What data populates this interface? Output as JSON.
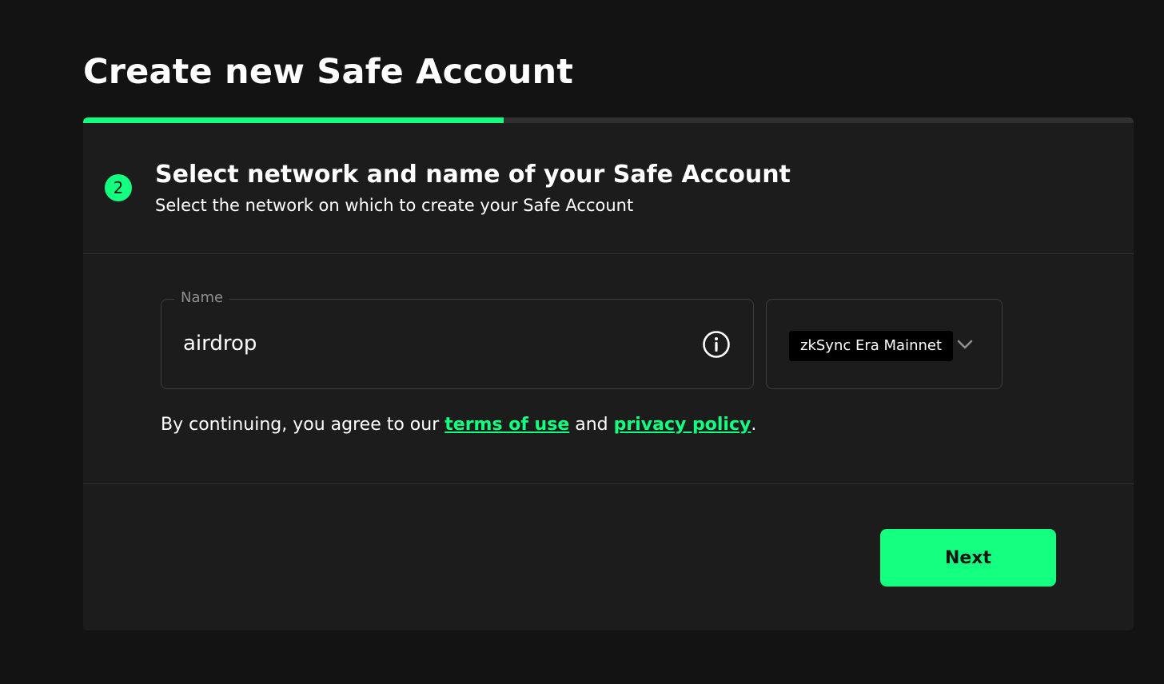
{
  "page": {
    "title": "Create new Safe Account"
  },
  "progress": {
    "fraction": 0.4,
    "color": "#12ff80"
  },
  "step": {
    "number": "2",
    "title": "Select network and name of your Safe Account",
    "subtitle": "Select the network on which to create your Safe Account"
  },
  "name_field": {
    "label": "Name",
    "value": "airdrop",
    "icon": "info-icon"
  },
  "network_select": {
    "selected": "zkSync Era Mainnet",
    "icon": "chevron-down-icon"
  },
  "terms": {
    "prefix": "By continuing, you agree to our ",
    "terms_link": "terms of use",
    "middle": " and ",
    "privacy_link": "privacy policy",
    "suffix": "."
  },
  "actions": {
    "next_label": "Next"
  },
  "colors": {
    "accent": "#12ff80",
    "background": "#121312",
    "card": "#1c1c1c"
  }
}
